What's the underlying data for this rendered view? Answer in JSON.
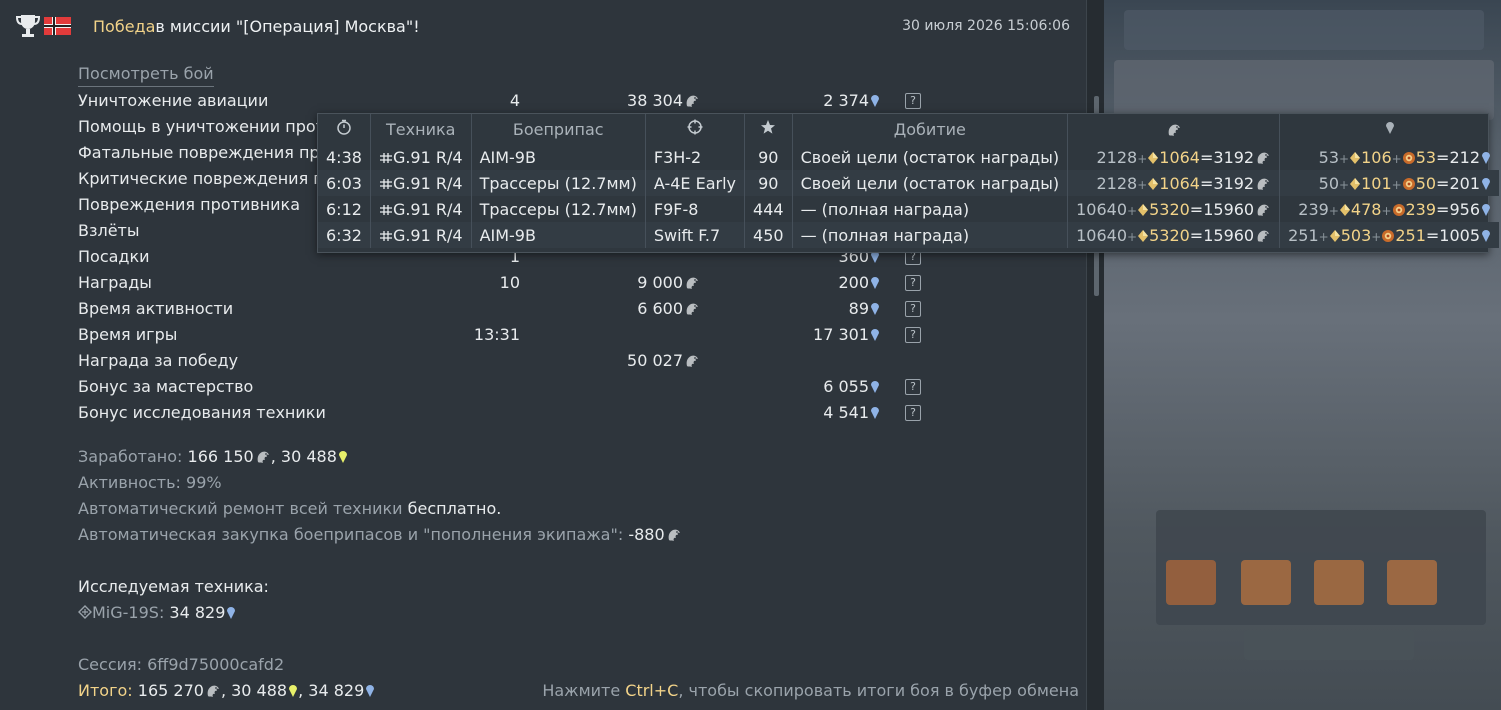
{
  "header": {
    "victory_word": "Победа",
    "mission_text": " в миссии \"[Операция] Москва\"!",
    "datetime": "30 июля 2026 15:06:06"
  },
  "view_battle_link": "Посмотреть бой",
  "stats": [
    {
      "name": "Уничтожение авиации",
      "count": "4",
      "sl": "38 304",
      "rp": "2 374",
      "q": true
    },
    {
      "name": "Помощь в уничтожении противника",
      "count": "",
      "sl": "",
      "rp": "",
      "q": false
    },
    {
      "name": "Фатальные повреждения противника",
      "count": "",
      "sl": "",
      "rp": "",
      "q": false
    },
    {
      "name": "Критические повреждения противника",
      "count": "",
      "sl": "",
      "rp": "",
      "q": false
    },
    {
      "name": "Повреждения противника",
      "count": "",
      "sl": "",
      "rp": "",
      "q": false
    },
    {
      "name": "Взлёты",
      "count": "",
      "sl": "",
      "rp": "",
      "q": false
    },
    {
      "name": "Посадки",
      "count": "1",
      "sl": "",
      "rp": "360",
      "q": true
    },
    {
      "name": "Награды",
      "count": "10",
      "sl": "9 000",
      "rp": "200",
      "q": true
    },
    {
      "name": "Время активности",
      "count": "",
      "sl": "6 600",
      "rp": "89",
      "q": true
    },
    {
      "name": "Время игры",
      "count": "13:31",
      "sl": "",
      "rp": "17 301",
      "q": true
    },
    {
      "name": "Награда за победу",
      "count": "",
      "sl": "50 027",
      "rp": "",
      "q": false
    },
    {
      "name": "Бонус за мастерство",
      "count": "",
      "sl": "",
      "rp": "6 055",
      "q": true
    },
    {
      "name": "Бонус исследования техники",
      "count": "",
      "sl": "",
      "rp": "4 541",
      "q": true
    }
  ],
  "summary": {
    "earned_label": "Заработано:",
    "earned_sl": "166 150",
    "earned_gp": "30 488",
    "activity_label": "Активность:",
    "activity_value": "99%",
    "repair_label": "Автоматический ремонт всей техники",
    "repair_value": "бесплатно.",
    "restock_label": "Автоматическая закупка боеприпасов и \"пополнения экипажа\":",
    "restock_value": "-880",
    "research_title": "Исследуемая техника:",
    "research_vehicle": "MiG-19S:",
    "research_rp": "34 829",
    "session_label": "Сессия:",
    "session_id": "6ff9d75000cafd2",
    "total_label": "Итого:",
    "total_sl": "165 270",
    "total_gp": "30 488",
    "total_rp": "34 829",
    "copy_hint_pre": "Нажмите ",
    "copy_hint_key": "Ctrl+C",
    "copy_hint_post": ", чтобы скопировать итоги боя в буфер обмена",
    "question_mark": "?"
  },
  "tooltip": {
    "columns": [
      "Техника",
      "Боеприпас",
      "Добитие"
    ],
    "rows": [
      {
        "time": "4:38",
        "vehicle": "G.91 R/4",
        "ammo": "AIM-9B",
        "target": "F3H-2",
        "score": "90",
        "finish": "Своей цели (остаток награды)",
        "sl_base": "2128",
        "sl_bonus": "1064",
        "sl_total": "=3192",
        "rp_base": "53",
        "rp_b1": "106",
        "rp_b2": "53",
        "rp_total": "=212"
      },
      {
        "time": "6:03",
        "vehicle": "G.91 R/4",
        "ammo": "Трассеры (12.7мм)",
        "target": "A-4E Early",
        "score": "90",
        "finish": "Своей цели (остаток награды)",
        "sl_base": "2128",
        "sl_bonus": "1064",
        "sl_total": "=3192",
        "rp_base": "50",
        "rp_b1": "101",
        "rp_b2": "50",
        "rp_total": "=201"
      },
      {
        "time": "6:12",
        "vehicle": "G.91 R/4",
        "ammo": "Трассеры (12.7мм)",
        "target": "F9F-8",
        "score": "444",
        "finish": "— (полная награда)",
        "sl_base": "10640",
        "sl_bonus": "5320",
        "sl_total": "=15960",
        "rp_base": "239",
        "rp_b1": "478",
        "rp_b2": "239",
        "rp_total": "=956"
      },
      {
        "time": "6:32",
        "vehicle": "G.91 R/4",
        "ammo": "AIM-9B",
        "target": "Swift F.7",
        "score": "450",
        "finish": "— (полная награда)",
        "sl_base": "10640",
        "sl_bonus": "5320",
        "sl_total": "=15960",
        "rp_base": "251",
        "rp_b1": "503",
        "rp_b2": "251",
        "rp_total": "=1005"
      }
    ]
  },
  "colors": {
    "gold": "#f2d389",
    "rp_blue": "#8fb3e6",
    "gp_yellow": "#e8f06a",
    "muted": "#9aa3ab"
  },
  "icons": [
    "trophy-icon",
    "flag-icon",
    "silver-lions-icon",
    "research-points-icon",
    "golden-eagles-icon",
    "stopwatch-icon",
    "crosshair-icon",
    "star-icon",
    "gold-bonus-icon",
    "booster-icon",
    "help-icon",
    "jet-icon",
    "research-vehicle-icon"
  ]
}
